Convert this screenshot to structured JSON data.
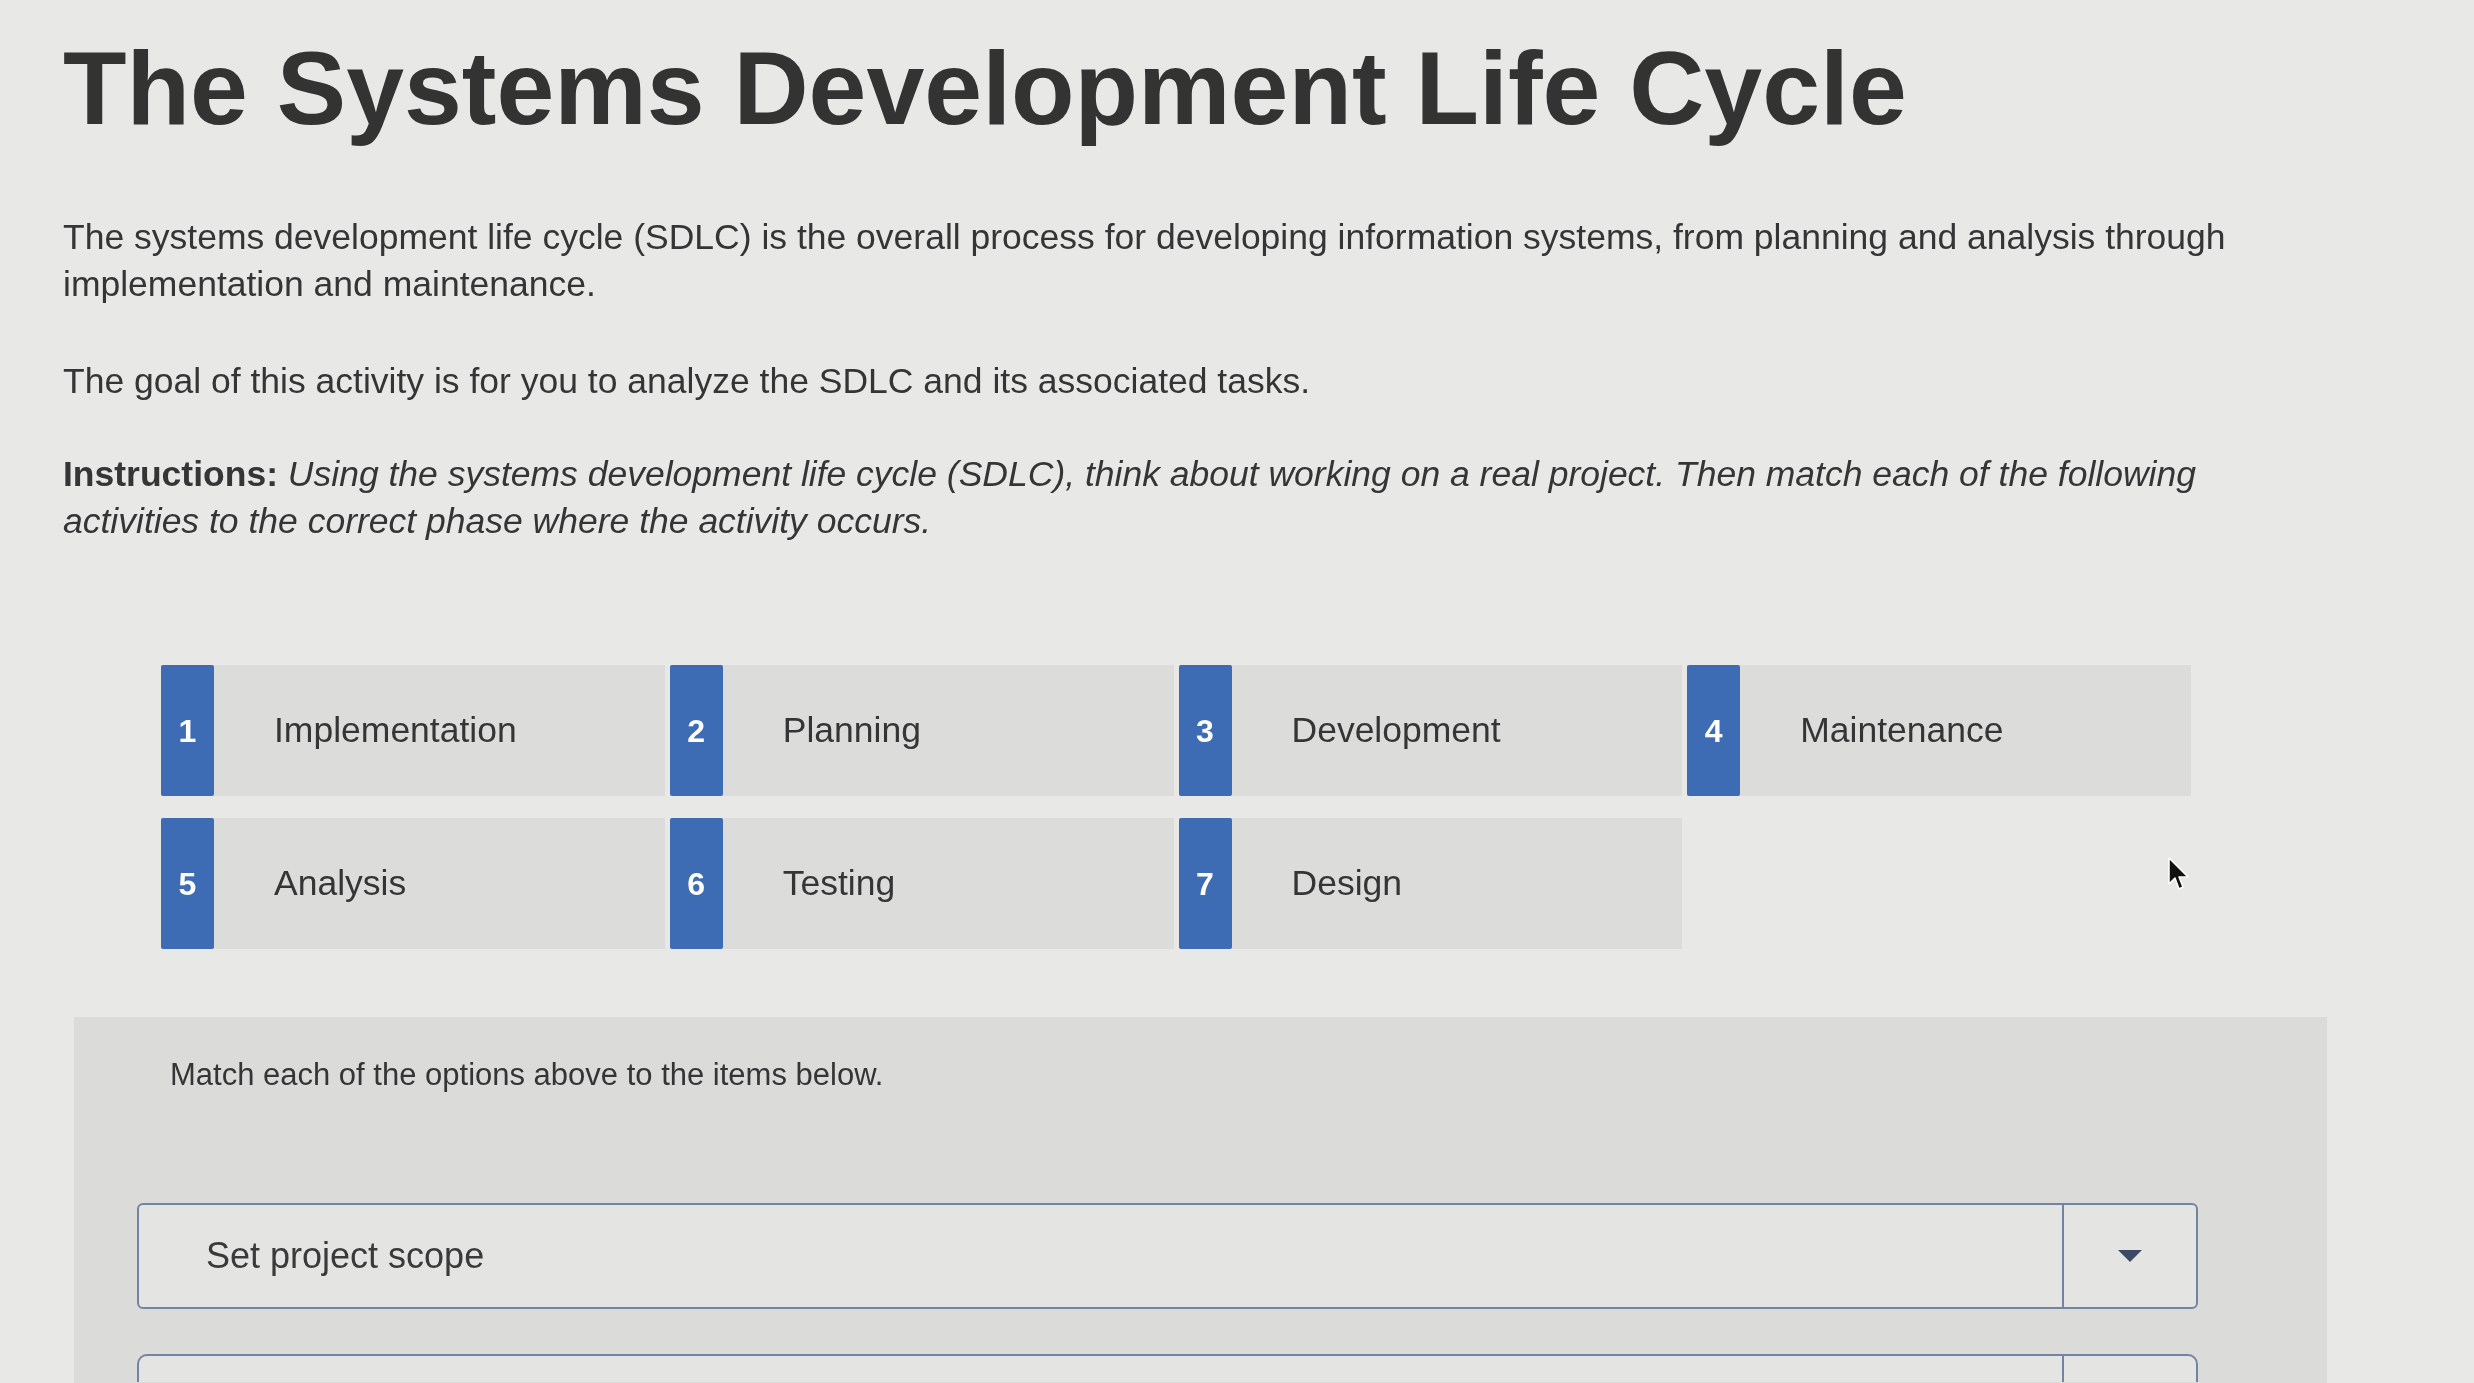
{
  "title": "The Systems Development Life Cycle",
  "intro": [
    "The systems development life cycle (SDLC) is the overall process for developing information systems, from planning and analysis through implementation and maintenance.",
    "The goal of this activity is for you to analyze the SDLC and its associated tasks."
  ],
  "instructions": "**Instructions:** *Using the systems development life cycle (SDLC), think about working on a real project. Then match each of the following activities to the correct phase where the activity occurs.*",
  "options": [
    {
      "number": "1",
      "label": "Implementation"
    },
    {
      "number": "2",
      "label": "Planning"
    },
    {
      "number": "3",
      "label": "Development"
    },
    {
      "number": "4",
      "label": "Maintenance"
    },
    {
      "number": "5",
      "label": "Analysis"
    },
    {
      "number": "6",
      "label": "Testing"
    },
    {
      "number": "7",
      "label": "Design"
    }
  ],
  "matching": {
    "prompt": "Match each of the options above to the items below.",
    "items": [
      {
        "value": "Set project scope"
      }
    ],
    "more_below": true
  }
}
